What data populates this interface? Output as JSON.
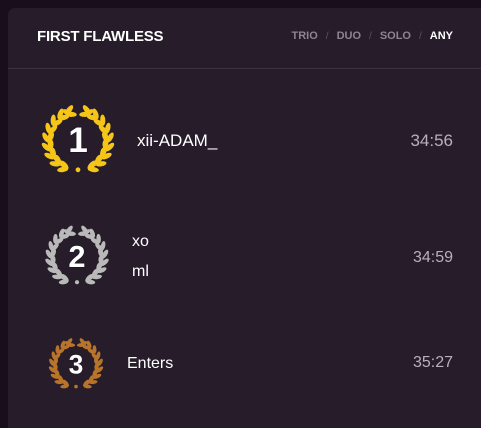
{
  "header": {
    "title": "FIRST FLAWLESS",
    "filters": [
      "TRIO",
      "DUO",
      "SOLO",
      "ANY"
    ],
    "separator": "/",
    "active_filter": "ANY"
  },
  "entries": [
    {
      "rank": "1",
      "medal": "gold-laurel-icon",
      "names": [
        "xii-ADAM_"
      ],
      "time": "34:56",
      "color": "#f5c518"
    },
    {
      "rank": "2",
      "medal": "silver-laurel-icon",
      "names": [
        "xo",
        "ml"
      ],
      "time": "34:59",
      "color": "#b9b9b9"
    },
    {
      "rank": "3",
      "medal": "bronze-laurel-icon",
      "names": [
        "Enters"
      ],
      "time": "35:27",
      "color": "#b8742a"
    }
  ]
}
